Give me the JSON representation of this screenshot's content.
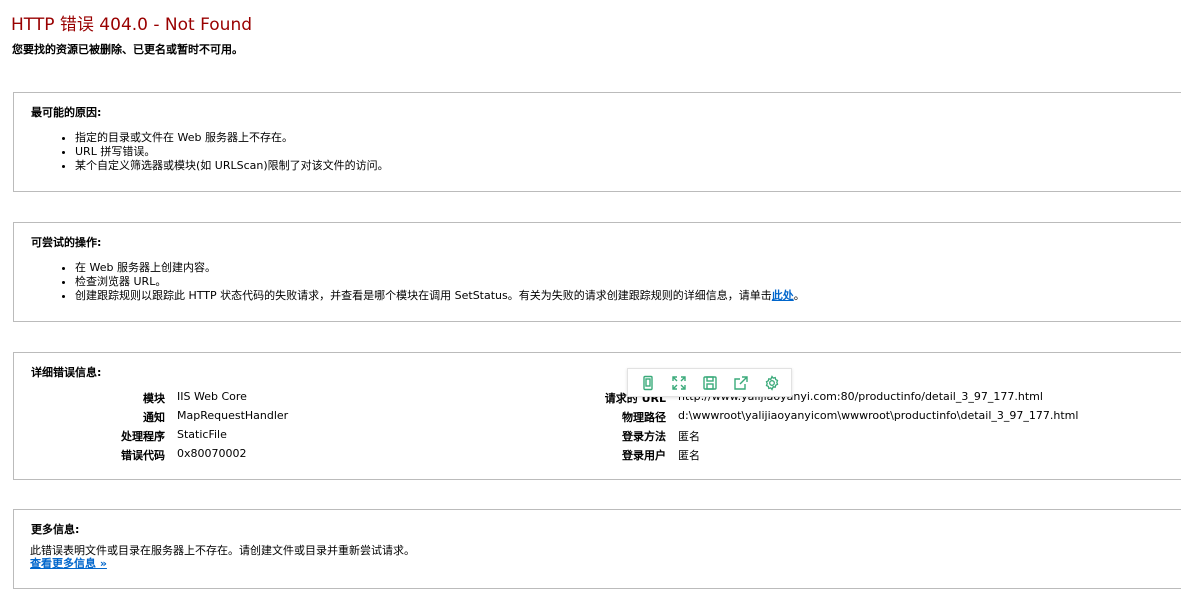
{
  "header": {
    "title": "HTTP 错误 404.0 - Not Found",
    "subtitle": "您要找的资源已被删除、已更名或暂时不可用。"
  },
  "causes": {
    "title": "最可能的原因:",
    "items": [
      "指定的目录或文件在 Web 服务器上不存在。",
      "URL 拼写错误。",
      "某个自定义筛选器或模块(如 URLScan)限制了对该文件的访问。"
    ]
  },
  "actions": {
    "title": "可尝试的操作:",
    "items": [
      "在 Web 服务器上创建内容。",
      "检查浏览器 URL。"
    ],
    "item3_text": "创建跟踪规则以跟踪此 HTTP 状态代码的失败请求，并查看是哪个模块在调用 SetStatus。有关为失败的请求创建跟踪规则的详细信息，请单击",
    "item3_link": "此处",
    "item3_suffix": "。"
  },
  "details": {
    "title": "详细错误信息:",
    "left": [
      {
        "key": "模块",
        "value": "IIS Web Core"
      },
      {
        "key": "通知",
        "value": "MapRequestHandler"
      },
      {
        "key": "处理程序",
        "value": "StaticFile"
      },
      {
        "key": "错误代码",
        "value": "0x80070002"
      }
    ],
    "right": [
      {
        "key": "请求的 URL",
        "value": "http://www.yalijiaoyanyi.com:80/productinfo/detail_3_97_177.html"
      },
      {
        "key": "物理路径",
        "value": "d:\\wwwroot\\yalijiaoyanyicom\\wwwroot\\productinfo\\detail_3_97_177.html"
      },
      {
        "key": "登录方法",
        "value": "匿名"
      },
      {
        "key": "登录用户",
        "value": "匿名"
      }
    ]
  },
  "more_info": {
    "title": "更多信息:",
    "text": "此错误表明文件或目录在服务器上不存在。请创建文件或目录并重新尝试请求。",
    "link": "查看更多信息 »"
  },
  "toolbar": {
    "icon_color": "#3aaa7a",
    "icons": [
      "phone-icon",
      "expand-icon",
      "save-icon",
      "share-icon",
      "gear-icon"
    ]
  }
}
